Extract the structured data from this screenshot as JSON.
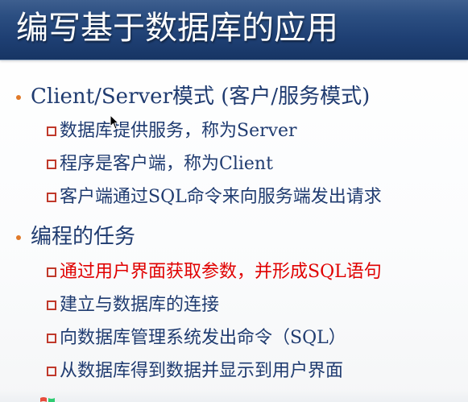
{
  "theme": {
    "accent": "#e07a2a",
    "title_bg": "#1f3f73",
    "text_color": "#1f3b70",
    "highlight_color": "#e00000",
    "sub_bullet_color": "#c0392b"
  },
  "title": "编写基于数据库的应用",
  "sections": [
    {
      "heading": "Client/Server模式 (客户/服务模式)",
      "items": [
        {
          "text": "数据库提供服务，称为Server",
          "highlight": false
        },
        {
          "text": "程序是客户端，称为Client",
          "highlight": false
        },
        {
          "text": "客户端通过SQL命令来向服务端发出请求",
          "highlight": false
        }
      ]
    },
    {
      "heading": "编程的任务",
      "items": [
        {
          "text": "通过用户界面获取参数，并形成SQL语句",
          "highlight": true
        },
        {
          "text": "建立与数据库的连接",
          "highlight": false
        },
        {
          "text": "向数据库管理系统发出命令（SQL）",
          "highlight": false
        },
        {
          "text": "从数据库得到数据并显示到用户界面",
          "highlight": false
        }
      ]
    }
  ],
  "icons": {
    "section_bullet": "bullet-dot-icon",
    "item_bullet": "square-bullet-icon",
    "pointer": "mouse-cursor-icon",
    "corner": "windows-logo-icon"
  }
}
